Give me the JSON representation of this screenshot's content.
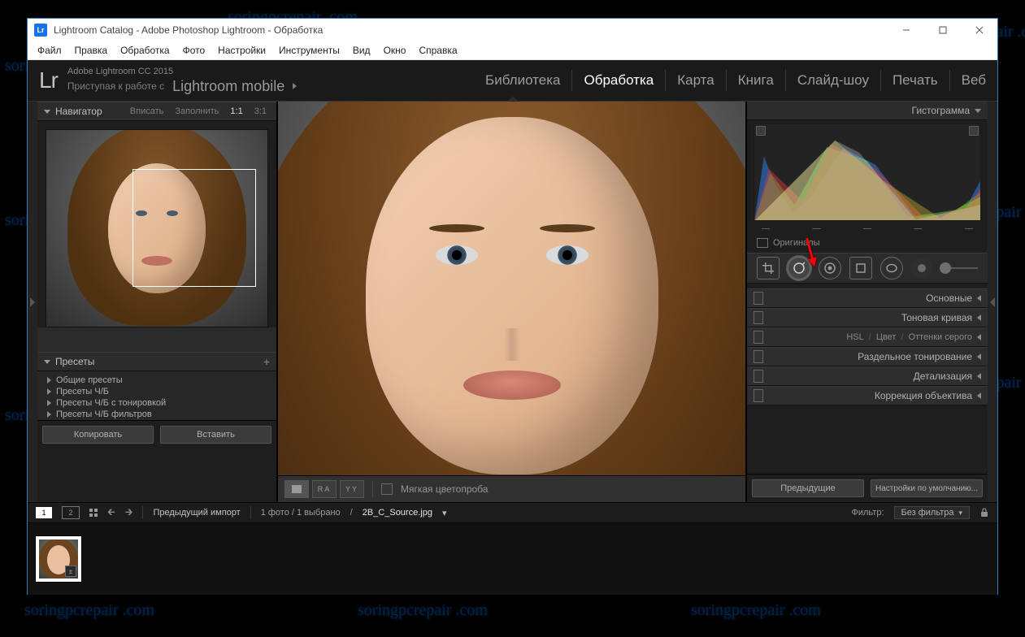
{
  "window": {
    "title": "Lightroom Catalog - Adobe Photoshop Lightroom - Обработка",
    "app_icon_text": "Lr"
  },
  "menubar": [
    "Файл",
    "Правка",
    "Обработка",
    "Фото",
    "Настройки",
    "Инструменты",
    "Вид",
    "Окно",
    "Справка"
  ],
  "header": {
    "logo": "Lr",
    "product": "Adobe Lightroom CC 2015",
    "mobile_prompt_prefix": "Приступая к работе с ",
    "mobile_prompt_brand": "Lightroom mobile"
  },
  "modules": [
    {
      "label": "Библиотека",
      "active": false
    },
    {
      "label": "Обработка",
      "active": true
    },
    {
      "label": "Карта",
      "active": false
    },
    {
      "label": "Книга",
      "active": false
    },
    {
      "label": "Слайд-шоу",
      "active": false
    },
    {
      "label": "Печать",
      "active": false
    },
    {
      "label": "Веб",
      "active": false
    }
  ],
  "navigator": {
    "title": "Навигатор",
    "opts": [
      "Вписать",
      "Заполнить",
      "1:1",
      "3:1"
    ]
  },
  "presets": {
    "title": "Пресеты",
    "items": [
      "Общие пресеты",
      "Пресеты Ч/Б",
      "Пресеты Ч/Б с тонировкой",
      "Пресеты Ч/Б фильтров"
    ]
  },
  "left_buttons": {
    "copy": "Копировать",
    "paste": "Вставить"
  },
  "center_toolbar": {
    "softproof_label": "Мягкая цветопроба",
    "views": [
      "RA",
      "YY"
    ]
  },
  "right": {
    "histogram_label": "Гистограмма",
    "original_label": "Оригиналы",
    "rows": [
      {
        "label": "Основные"
      },
      {
        "label": "Тоновая кривая"
      },
      {
        "label": "HSL",
        "sub": [
          "Цвет",
          "Оттенки серого"
        ]
      },
      {
        "label": "Раздельное тонирование"
      },
      {
        "label": "Детализация"
      },
      {
        "label": "Коррекция объектива"
      }
    ],
    "buttons": {
      "prev": "Предыдущие",
      "defaults": "Настройки по умолчанию..."
    },
    "hist_controls": [
      "—",
      "—",
      "—",
      "—",
      "—"
    ]
  },
  "footer": {
    "source_label": "Предыдущий импорт",
    "count_label": "1 фото / 1 выбрано",
    "filename": "2B_C_Source.jpg",
    "filter_label": "Фильтр:",
    "filter_value": "Без фильтра",
    "view1": "1",
    "view2": "2"
  }
}
